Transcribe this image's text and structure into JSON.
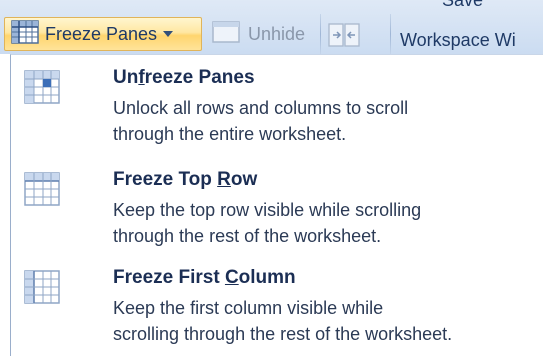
{
  "ribbon": {
    "freeze_panes_label": "Freeze Panes",
    "unhide_label": "Unhide",
    "save_workspace_line1": "Save",
    "save_workspace_line2": "Workspace Wi"
  },
  "menu": {
    "items": [
      {
        "title_pre": "Un",
        "title_key": "f",
        "title_post": "reeze Panes",
        "desc_line1": "Unlock all rows and columns to scroll",
        "desc_line2": "through the entire worksheet."
      },
      {
        "title_pre": "Freeze Top ",
        "title_key": "R",
        "title_post": "ow",
        "desc_line1": "Keep the top row visible while scrolling",
        "desc_line2": "through the rest of the worksheet."
      },
      {
        "title_pre": "Freeze First ",
        "title_key": "C",
        "title_post": "olumn",
        "desc_line1": "Keep the first column visible while",
        "desc_line2": "scrolling through the rest of the worksheet."
      }
    ]
  },
  "icons": {
    "freeze_panes": "grid-freeze-icon",
    "unhide": "window-icon",
    "side_by_side": "side-by-side-icon",
    "unfreeze": "unfreeze-panes-icon",
    "freeze_top_row": "freeze-top-row-icon",
    "freeze_first_column": "freeze-first-column-icon"
  },
  "colors": {
    "ribbon_bg": "#d3e1f3",
    "hover_highlight": "#ffd56e",
    "title_text": "#1b2e54",
    "disabled_text": "#8a97aa"
  }
}
